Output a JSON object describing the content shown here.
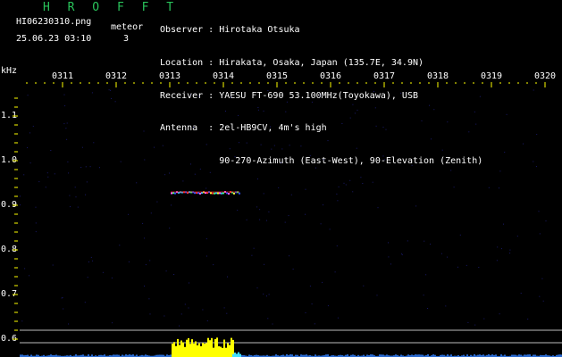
{
  "header": {
    "app_title": "H R O F F T",
    "filename": "HI06230310.png",
    "meteor_label": "meteor",
    "datetime": "25.06.23 03:10",
    "meteor_count": "3"
  },
  "station": {
    "observer": "Observer : Hirotaka Otsuka",
    "location": "Location : Hirakata, Osaka, Japan (135.7E, 34.9N)",
    "receiver": "Receiver : YAESU FT-690 53.100MHz(Toyokawa), USB",
    "antenna": "Antenna  : 2el-HB9CV, 4m's high",
    "antenna2": "           90-270-Azimuth (East-West), 90-Elevation (Zenith)"
  },
  "spectrogram": {
    "y_unit": "kHz",
    "y_ticks": [
      "1.1",
      "1.0",
      "0.9",
      "0.8",
      "0.7",
      "0.6"
    ],
    "x_ticks": [
      "0311",
      "0312",
      "0313",
      "0314",
      "0315",
      "0316",
      "0317",
      "0318",
      "0319",
      "0320"
    ],
    "colors": {
      "background": "#000000",
      "tick": "#ffff00",
      "echo": "#ff3030",
      "noise": "#ffff00",
      "title": "#29c25a"
    },
    "meteor_echo_khz": 0.93,
    "meteor_echo_minutes": [
      "0313",
      "0314"
    ]
  }
}
